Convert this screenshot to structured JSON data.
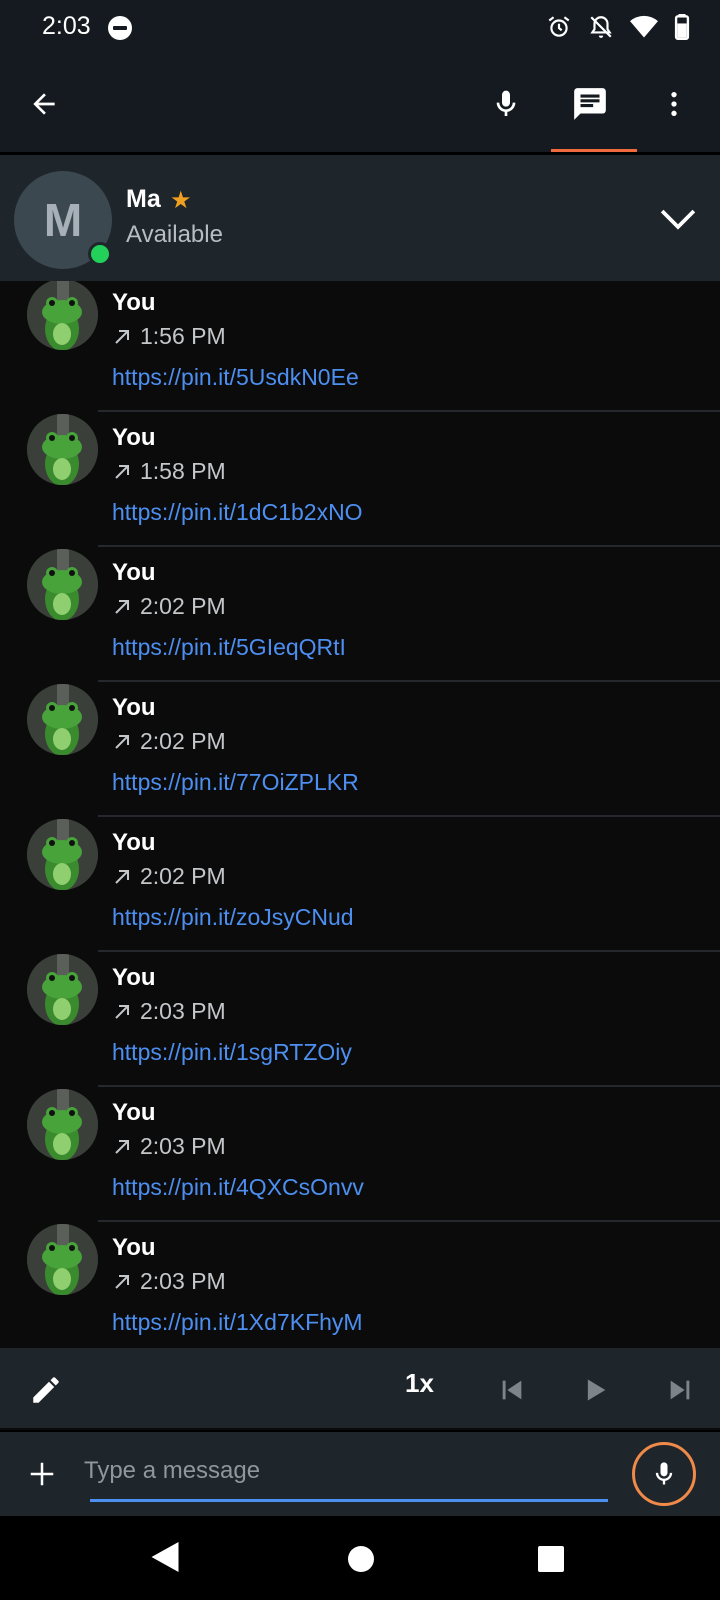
{
  "status_bar": {
    "time": "2:03"
  },
  "contact": {
    "initial": "M",
    "name": "Ma",
    "status": "Available"
  },
  "messages": [
    {
      "sender": "You",
      "time": "1:56 PM",
      "link": "https://pin.it/5UsdkN0Ee"
    },
    {
      "sender": "You",
      "time": "1:58 PM",
      "link": "https://pin.it/1dC1b2xNO"
    },
    {
      "sender": "You",
      "time": "2:02 PM",
      "link": "https://pin.it/5GIeqQRtI"
    },
    {
      "sender": "You",
      "time": "2:02 PM",
      "link": "https://pin.it/77OiZPLKR"
    },
    {
      "sender": "You",
      "time": "2:02 PM",
      "link": "https://pin.it/zoJsyCNud"
    },
    {
      "sender": "You",
      "time": "2:03 PM",
      "link": "https://pin.it/1sgRTZOiy"
    },
    {
      "sender": "You",
      "time": "2:03 PM",
      "link": "https://pin.it/4QXCsOnvv"
    },
    {
      "sender": "You",
      "time": "2:03 PM",
      "link": "https://pin.it/1Xd7KFhyM"
    }
  ],
  "player": {
    "speed": "1x"
  },
  "compose": {
    "placeholder": "Type a message"
  },
  "colors": {
    "accent": "#f06a3e",
    "link": "#4d8ff0",
    "online": "#22d05a",
    "star": "#f0a020"
  }
}
